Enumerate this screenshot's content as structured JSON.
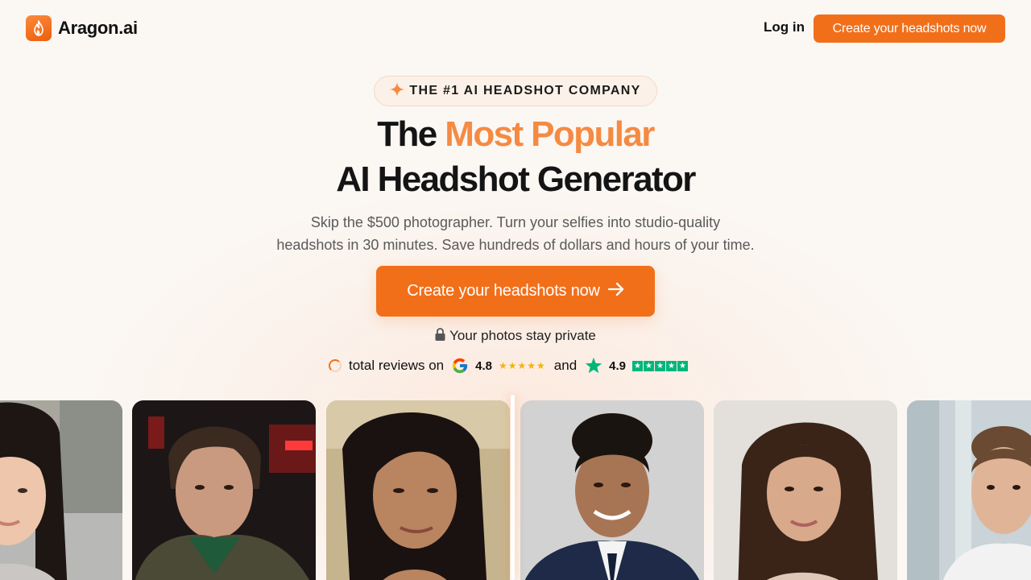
{
  "header": {
    "brand": "Aragon.ai",
    "login_label": "Log in",
    "cta_label": "Create your headshots now"
  },
  "hero": {
    "badge_text": "THE #1 AI HEADSHOT COMPANY",
    "title_part1": "The ",
    "title_accent": "Most Popular",
    "title_line2": "AI Headshot Generator",
    "subtitle_line1": "Skip the $500 photographer. Turn your selfies into studio-quality",
    "subtitle_line2": "headshots in 30 minutes. Save hundreds of dollars and hours of your time.",
    "cta_label": "Create your headshots now",
    "privacy_text": "Your photos stay private"
  },
  "reviews": {
    "prefix": "total reviews on",
    "google_rating": "4.8",
    "google_stars": "★★★★★",
    "conjunction": "and",
    "trustpilot_rating": "4.9"
  },
  "colors": {
    "brand": "#f26f1a",
    "accent_text": "#f58a43",
    "background": "#fbf7f3"
  },
  "photos": [
    {
      "name": "photo-selfie-woman-1"
    },
    {
      "name": "photo-selfie-man-1"
    },
    {
      "name": "photo-selfie-woman-2"
    },
    {
      "name": "photo-headshot-man-1"
    },
    {
      "name": "photo-headshot-woman-2"
    },
    {
      "name": "photo-headshot-man-2"
    }
  ]
}
